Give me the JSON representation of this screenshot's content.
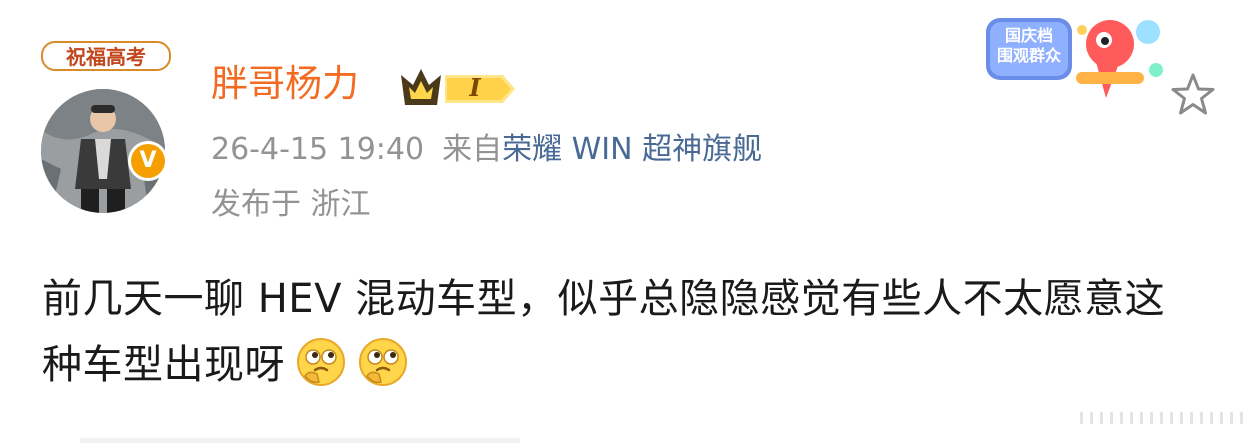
{
  "post": {
    "avatar_banner_text": "祝福高考",
    "author": {
      "name": "胖哥杨力",
      "vip_level": "I",
      "verified_mark": "V"
    },
    "meta": {
      "timestamp": "26-4-15 19:40",
      "source_prefix": "来自",
      "device": "荣耀 WIN 超神旗舰",
      "location": "发布于 浙江"
    },
    "event_badge": {
      "line1": "国庆档",
      "line2": "围观群众"
    },
    "content_text": "前几天一聊 HEV 混动车型，似乎总隐隐感觉有些人不太愿意这种车型出现呀"
  },
  "icons": {
    "favorite": "star-outline-icon",
    "emoji": "thinking-face-icon",
    "vip": "crown-vip-icon",
    "verified": "verified-v-icon"
  },
  "colors": {
    "username": "#f36b21",
    "meta_gray": "#939393",
    "device_link": "#4a6a96",
    "verified_orange": "#f5a000",
    "body_text": "#1a1a1a"
  }
}
